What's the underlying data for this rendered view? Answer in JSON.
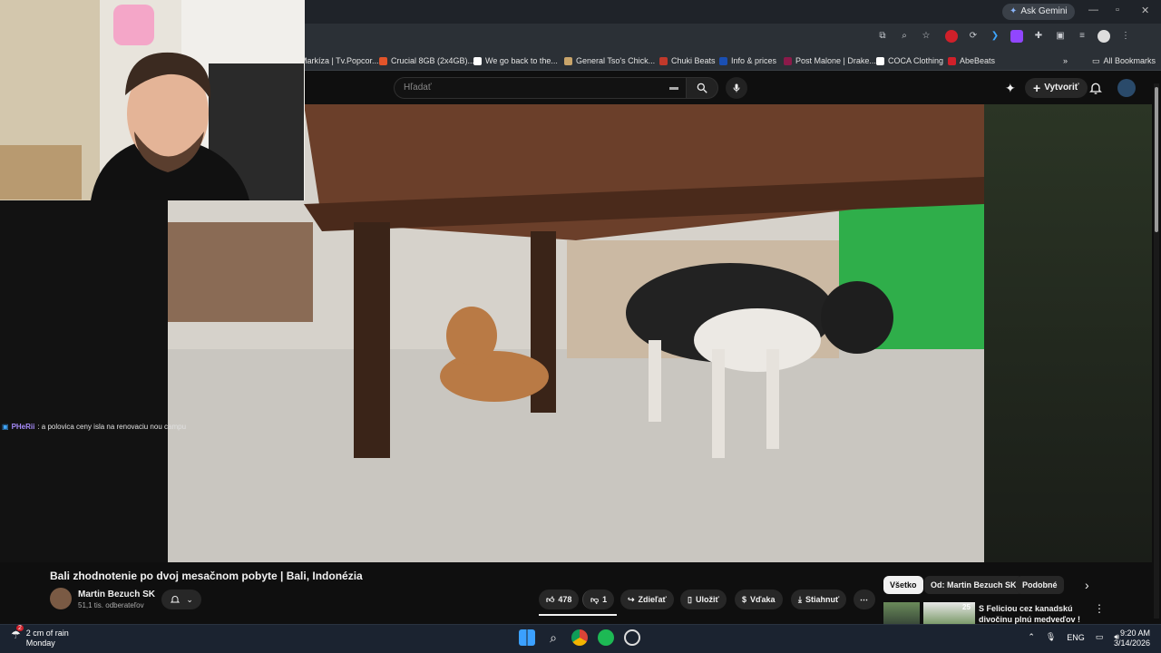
{
  "browser": {
    "ask_gemini": "Ask Gemini",
    "bookmarks": [
      {
        "label": "Markíza | Tv.Popcor...",
        "color": "#2b3036"
      },
      {
        "label": "Crucial 8GB (2x4GB)...",
        "color": "#e2542a"
      },
      {
        "label": "We go back to the...",
        "color": "#ffffff"
      },
      {
        "label": "General Tso's Chick...",
        "color": "#c8a46a"
      },
      {
        "label": "Chuki Beats",
        "color": "#c0392b"
      },
      {
        "label": "Info & prices",
        "color": "#1a4fb3"
      },
      {
        "label": "Post Malone | Drake...",
        "color": "#8b1a4a"
      },
      {
        "label": "COCA Clothing",
        "color": "#ffffff"
      },
      {
        "label": "AbeBeats",
        "color": "#d0202a"
      }
    ],
    "all_bookmarks": "All Bookmarks"
  },
  "youtube": {
    "search_placeholder": "Hľadať",
    "create_label": "Vytvoriť",
    "video_title": "Bali zhodnotenie po dvoj mesačnom pobyte | Bali, Indonézia",
    "channel_name": "Martin Bezuch SK",
    "channel_subs": "51,1 tis. odberateľov",
    "likes": "478",
    "dislikes": "1",
    "share_label": "Zdieľať",
    "save_label": "Uložiť",
    "thanks_label": "Vďaka",
    "download_label": "Stiahnuť",
    "chips": [
      {
        "label": "Všetko",
        "active": true
      },
      {
        "label": "Od: Martin Bezuch SK",
        "active": false
      },
      {
        "label": "Podobné",
        "active": false
      }
    ],
    "recommendation": {
      "title": "S Feliciou cez kanadskú divočinu plnú medveďov ! 🇨🇦 ...",
      "duration": "25"
    }
  },
  "stream_chat": {
    "user": "PHeRii",
    "message": ": a polovica ceny isla na renovaciu nou campu"
  },
  "taskbar": {
    "weather_line1": "2 cm of rain",
    "weather_line2": "Monday",
    "weather_badge": "2",
    "lang": "ENG",
    "time": "9:20 AM",
    "date": "3/14/2026"
  },
  "colors": {
    "yt_background": "#0f0f0f",
    "pill_background": "#272727",
    "taskbar": "#1b2330"
  }
}
